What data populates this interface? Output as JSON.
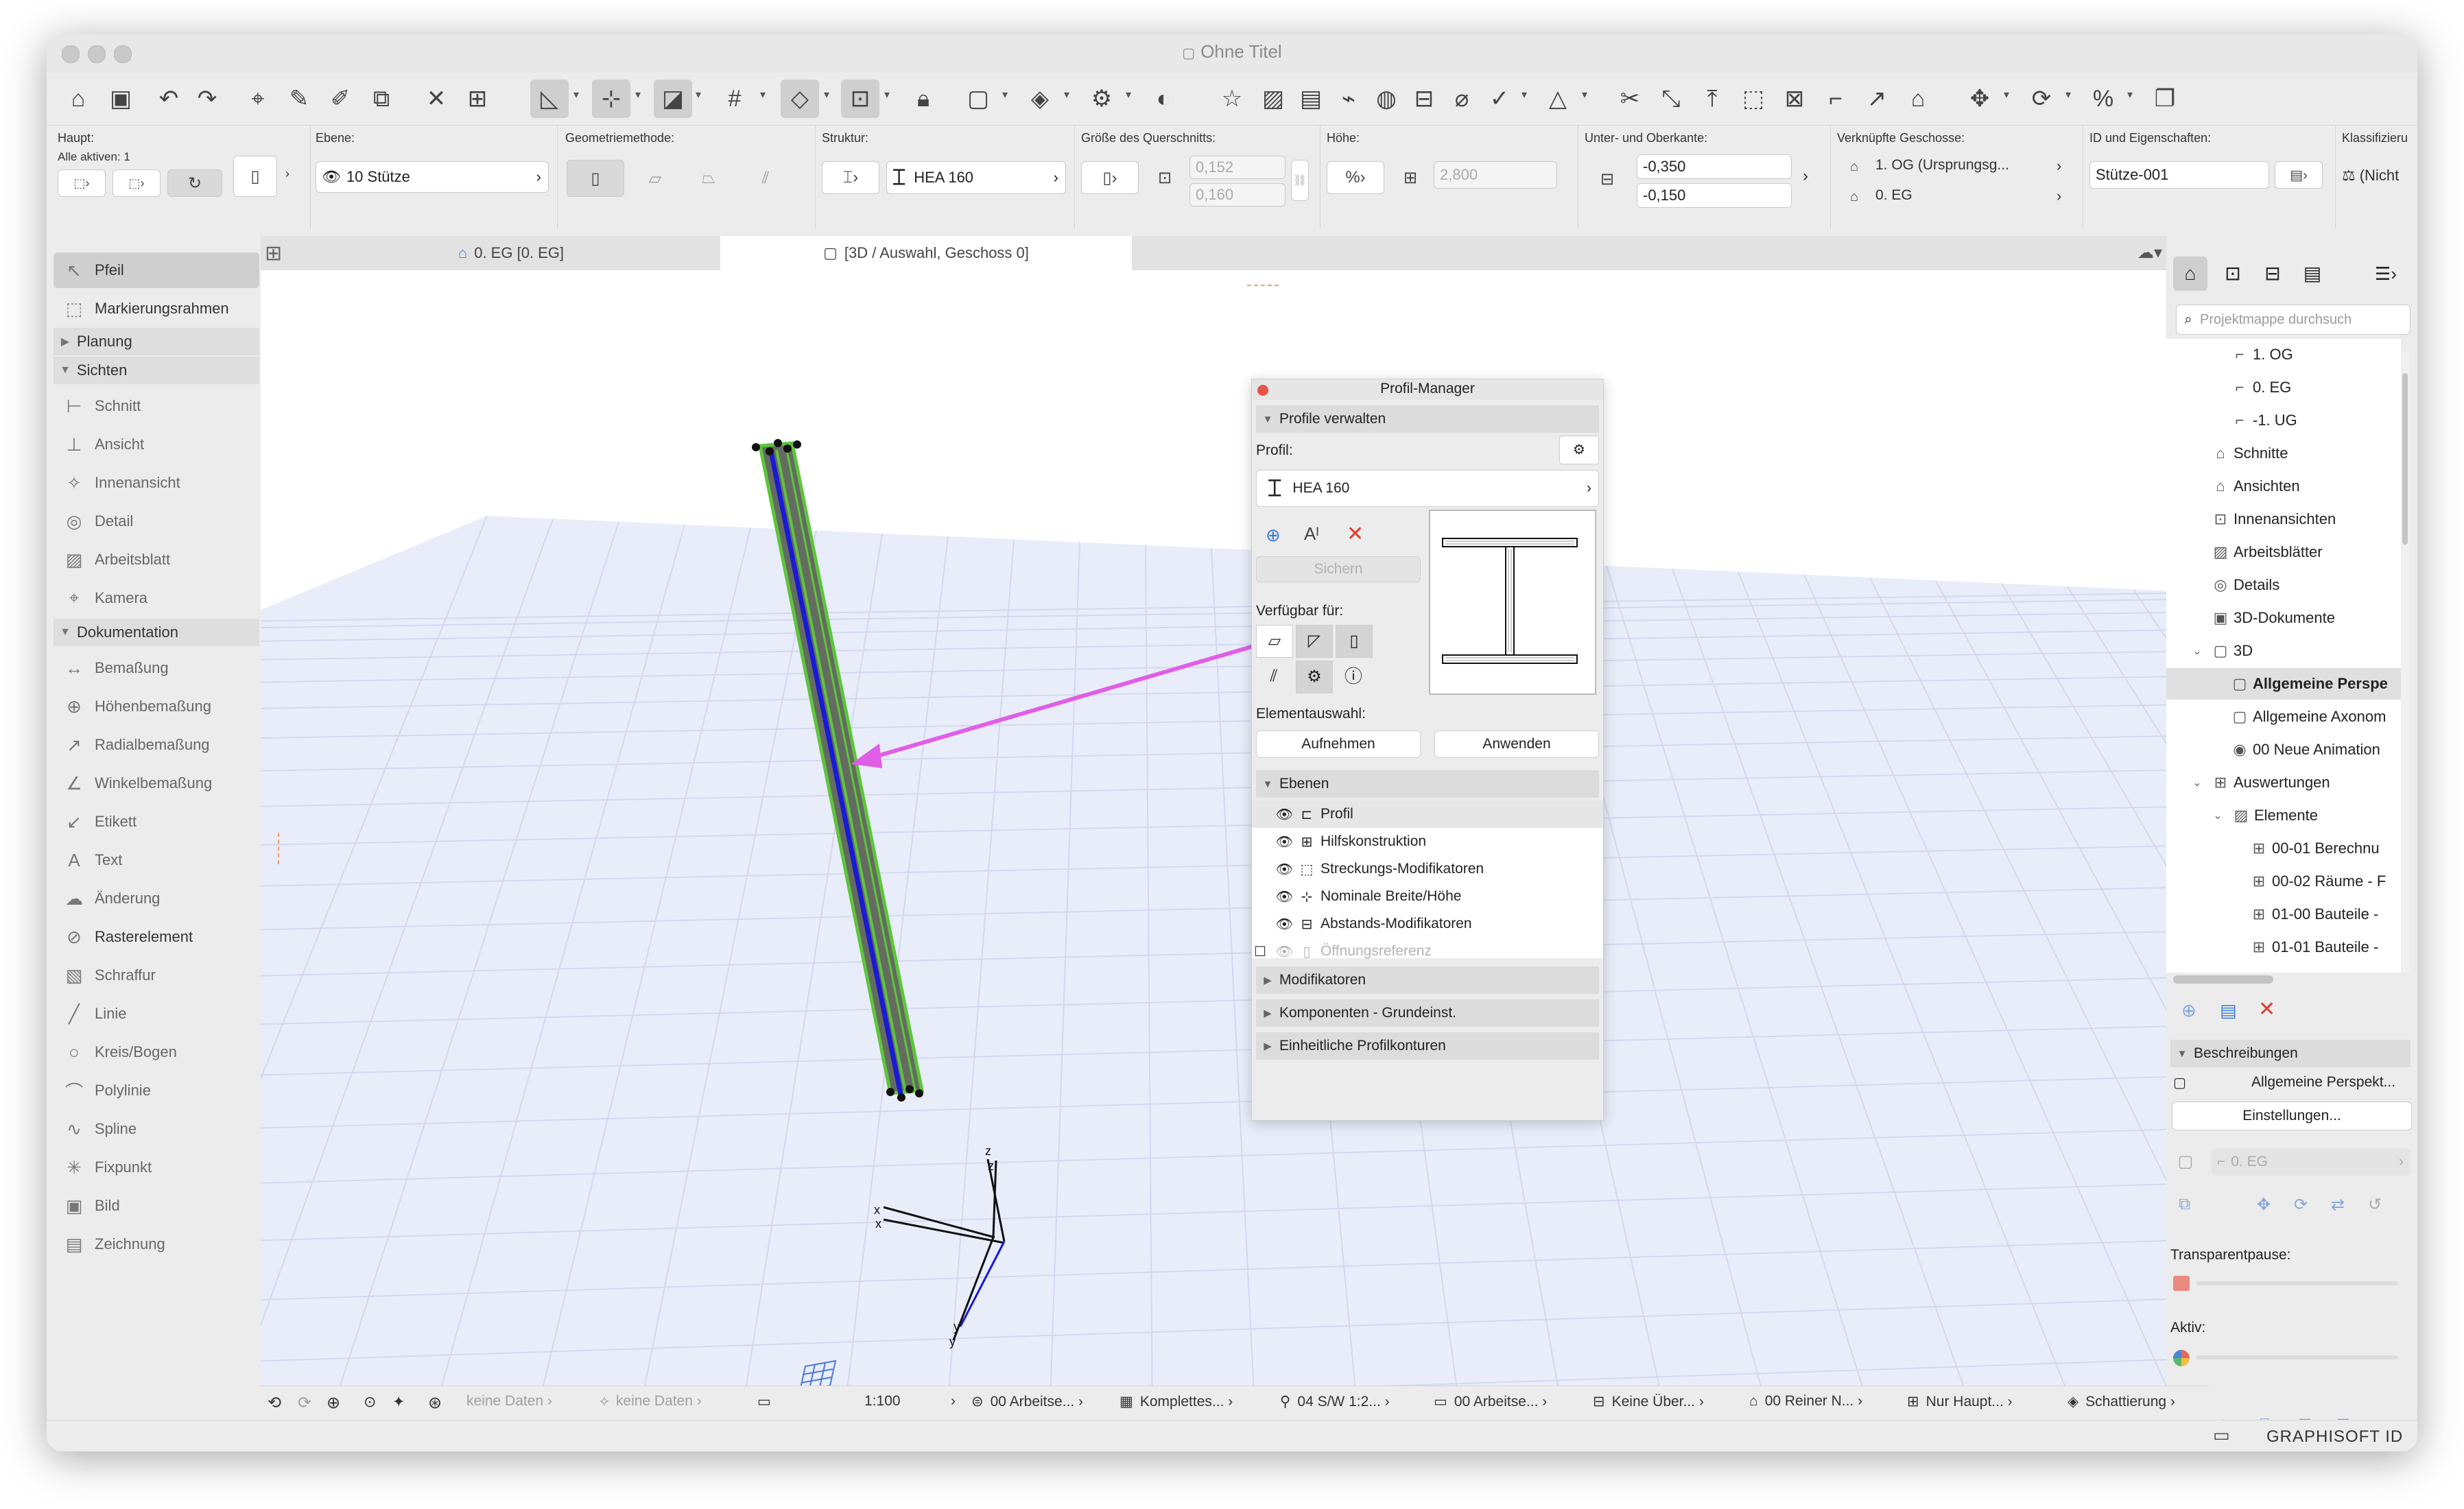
{
  "window": {
    "title": "Ohne Titel"
  },
  "infobox": {
    "haupt_label": "Haupt:",
    "alle_aktiven": "Alle aktiven: 1",
    "ebene_label": "Ebene:",
    "ebene_value": "10 Stütze",
    "geometrie_label": "Geometriemethode:",
    "struktur_label": "Struktur:",
    "struktur_value": "HEA 160",
    "groesse_label": "Größe des Querschnitts:",
    "groesse_w": "0,152",
    "groesse_h": "0,160",
    "hoehe_label": "Höhe:",
    "hoehe_value": "2,800",
    "unterkante_label": "Unter- und Oberkante:",
    "unterkante_value": "-0,350",
    "oberkante_value": "-0,150",
    "geschosse_label": "Verknüpfte Geschosse:",
    "geschoss_oben": "1. OG (Ursprungsg...",
    "geschoss_unten": "0. EG",
    "id_label": "ID und Eigenschaften:",
    "id_value": "Stütze-001",
    "klass_label": "Klassifizieru",
    "klass_value": "(Nicht"
  },
  "tabs": {
    "tab1": "0. EG [0. EG]",
    "tab2": "[3D / Auswahl, Geschoss 0]"
  },
  "toolbox": {
    "pfeil": "Pfeil",
    "markierung": "Markierungsrahmen",
    "planung": "Planung",
    "sichten": "Sichten",
    "schnitt": "Schnitt",
    "ansicht": "Ansicht",
    "innenansicht": "Innenansicht",
    "detail": "Detail",
    "arbeitsblatt": "Arbeitsblatt",
    "kamera": "Kamera",
    "dokumentation": "Dokumentation",
    "bemassung": "Bemaßung",
    "hoehenbemassung": "Höhenbemaßung",
    "radialbemassung": "Radialbemaßung",
    "winkelbemassung": "Winkelbemaßung",
    "etikett": "Etikett",
    "text": "Text",
    "aenderung": "Änderung",
    "rasterelement": "Rasterelement",
    "schraffur": "Schraffur",
    "linie": "Linie",
    "kreis": "Kreis/Bogen",
    "polylinie": "Polylinie",
    "spline": "Spline",
    "fixpunkt": "Fixpunkt",
    "bild": "Bild",
    "zeichnung": "Zeichnung"
  },
  "profile_manager": {
    "title": "Profil-Manager",
    "section_verwalten": "Profile verwalten",
    "profil_label": "Profil:",
    "profil_value": "HEA 160",
    "sichern": "Sichern",
    "verfuegbar": "Verfügbar für:",
    "elementauswahl": "Elementauswahl:",
    "aufnehmen": "Aufnehmen",
    "anwenden": "Anwenden",
    "section_ebenen": "Ebenen",
    "layers": [
      "Profil",
      "Hilfskonstruktion",
      "Streckungs-Modifikatoren",
      "Nominale Breite/Höhe",
      "Abstands-Modifikatoren",
      "Öffnungsreferenz"
    ],
    "section_modifikatoren": "Modifikatoren",
    "section_komponenten": "Komponenten - Grundeinst.",
    "section_profilkonturen": "Einheitliche Profilkonturen"
  },
  "navigator": {
    "search_placeholder": "Projektmappe durchsuch",
    "items": [
      "1. OG",
      "0. EG",
      "-1. UG",
      "Schnitte",
      "Ansichten",
      "Innenansichten",
      "Arbeitsblätter",
      "Details",
      "3D-Dokumente",
      "3D",
      "Allgemeine Perspe",
      "Allgemeine Axonom",
      "00 Neue Animation",
      "Auswertungen",
      "Elemente",
      "00-01 Berechnu",
      "00-02 Räume - F",
      "01-00 Bauteile -",
      "01-01 Bauteile -"
    ],
    "beschreibungen": "Beschreibungen",
    "beschreibung_value": "Allgemeine Perspekt...",
    "einstellungen": "Einstellungen...",
    "geschoss_dim": "0. EG",
    "transparent": "Transparentpause:",
    "aktiv": "Aktiv:"
  },
  "statusbar": {
    "keine_daten_1": "keine Daten",
    "keine_daten_2": "keine Daten",
    "massstab": "1:100",
    "ebenenkomb": "00 Arbeitse...",
    "modell": "Komplettes...",
    "stift": "04 S/W 1:2...",
    "uebers": "00 Arbeitse...",
    "ueberschr": "Keine Über...",
    "renov": "00 Reiner N...",
    "haupt": "Nur Haupt...",
    "schattierung": "Schattierung"
  },
  "bottom": {
    "graphisoft": "GRAPHISOFT ID"
  },
  "colors": {
    "column_fill": "#646b60",
    "column_outline": "#5ec53c",
    "column_axis": "#1a1ad6",
    "arrow": "#e05ee6",
    "grid_plane": "#e9edf9",
    "delete_red": "#e03a2a",
    "accent_blue": "#3a7bd5"
  }
}
